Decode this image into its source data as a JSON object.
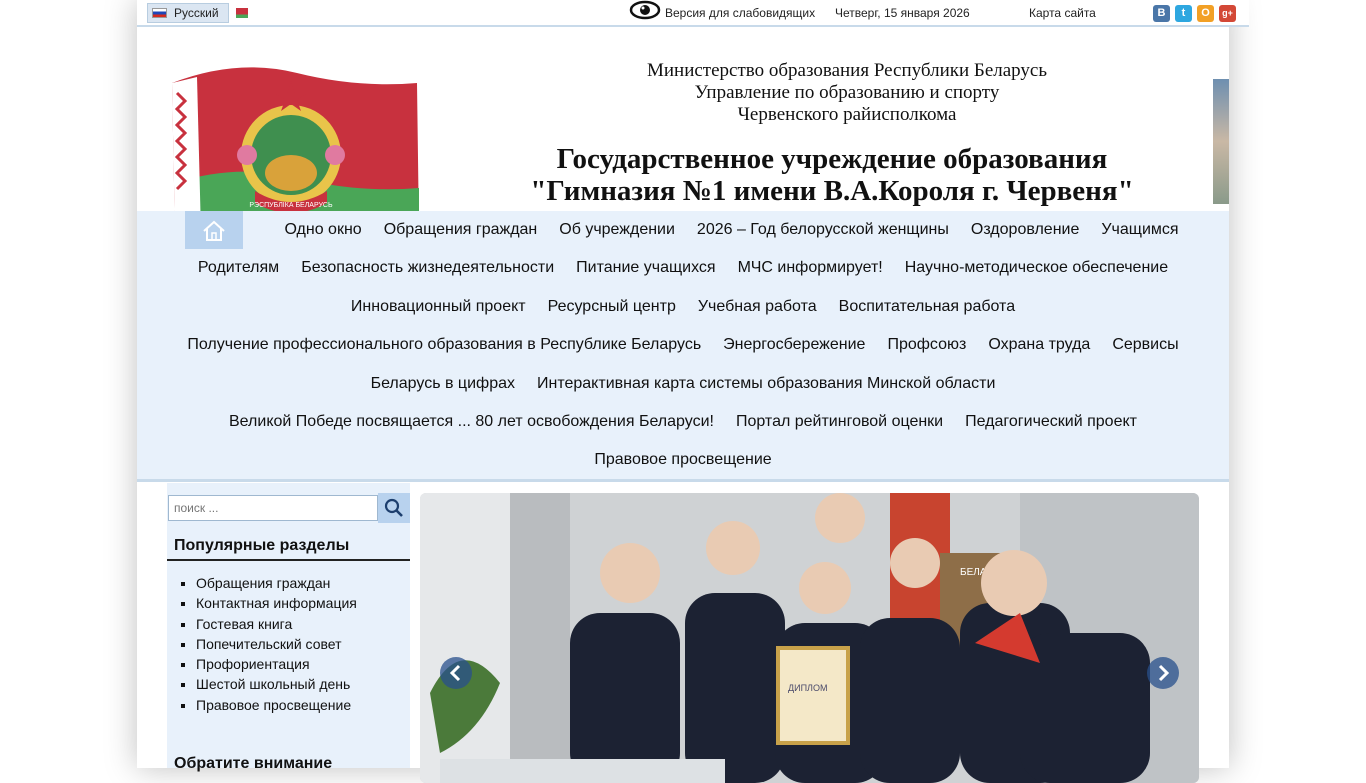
{
  "topbar": {
    "language": "Русский",
    "accessibility": "Версия для слабовидящих",
    "date": "Четверг, 15 января 2026",
    "sitemap": "Карта сайта",
    "social": [
      "В",
      "t",
      "О",
      "g+"
    ]
  },
  "header": {
    "line1": "Министерство образования Республики Беларусь",
    "line2": "Управление по образованию и спорту",
    "line3": "Червенского райисполкома",
    "title1": "Государственное учреждение образования",
    "title2": "\"Гимназия №1 имени В.А.Короля г. Червеня\"",
    "emblem_ribbon": "РЭСПУБЛІКА БЕЛАРУСЬ"
  },
  "nav": {
    "rows": [
      [
        "Одно окно",
        "Обращения граждан",
        "Об учреждении",
        "2026 – Год белорусской женщины",
        "Оздоровление",
        "Учащимся"
      ],
      [
        "Родителям",
        "Безопасность жизнедеятельности",
        "Питание учащихся",
        "МЧС информирует!",
        "Научно-методическое обеспечение"
      ],
      [
        "Инновационный проект",
        "Ресурсный центр",
        "Учебная работа",
        "Воспитательная работа"
      ],
      [
        "Получение профессионального образования в Республике Беларусь",
        "Энергосбережение",
        "Профсоюз",
        "Охрана труда",
        "Сервисы"
      ],
      [
        "Беларусь в цифрах",
        "Интерактивная карта системы образования Минской области"
      ],
      [
        "Великой Победе посвящается ... 80 лет освобождения Беларуси!",
        "Портал рейтинговой оценки",
        "Педагогический проект"
      ],
      [
        "Правовое просвещение"
      ]
    ]
  },
  "sidebar": {
    "search_placeholder": "поиск ...",
    "popular_title": "Популярные разделы",
    "popular": [
      "Обращения граждан",
      "Контактная информация",
      "Гостевая книга",
      "Попечительский совет",
      "Профориентация",
      "Шестой школьный день",
      "Правовое просвещение"
    ],
    "attention_title": "Обратите внимание"
  },
  "slider": {
    "board_text": "БЕЛАРУСЬ",
    "diploma_text": "ДИПЛОМ"
  }
}
